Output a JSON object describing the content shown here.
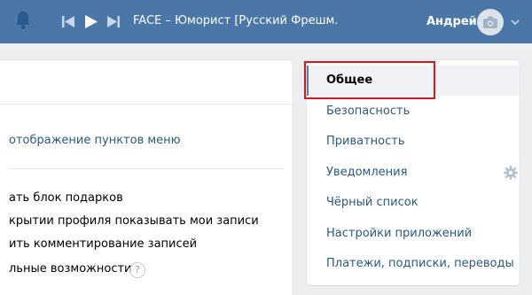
{
  "header": {
    "track_title": "FACE – Юморист [Русский Фрешм...",
    "user_name": "Андрей"
  },
  "main": {
    "menu_display_link": "отображение пунктов меню",
    "options": [
      "ать блок подарков",
      "крытии профиля показывать мои записи",
      "ить комментирование записей",
      "льные возможности"
    ],
    "help_symbol": "?"
  },
  "side_menu": {
    "items": [
      {
        "label": "Общее",
        "active": true
      },
      {
        "label": "Безопасность",
        "active": false
      },
      {
        "label": "Приватность",
        "active": false
      },
      {
        "label": "Уведомления",
        "active": false
      },
      {
        "label": "Чёрный список",
        "active": false
      },
      {
        "label": "Настройки приложений",
        "active": false
      },
      {
        "label": "Платежи, подписки, переводы",
        "active": false
      }
    ]
  },
  "colors": {
    "header_bg": "#4a76a8",
    "link": "#2a5885",
    "highlight": "#e3111b",
    "page_bg": "#edeef0"
  },
  "icons": [
    "bell-icon",
    "prev-track-icon",
    "play-icon",
    "next-track-icon",
    "camera-icon",
    "chevron-down-icon",
    "help-icon",
    "gear-icon"
  ]
}
